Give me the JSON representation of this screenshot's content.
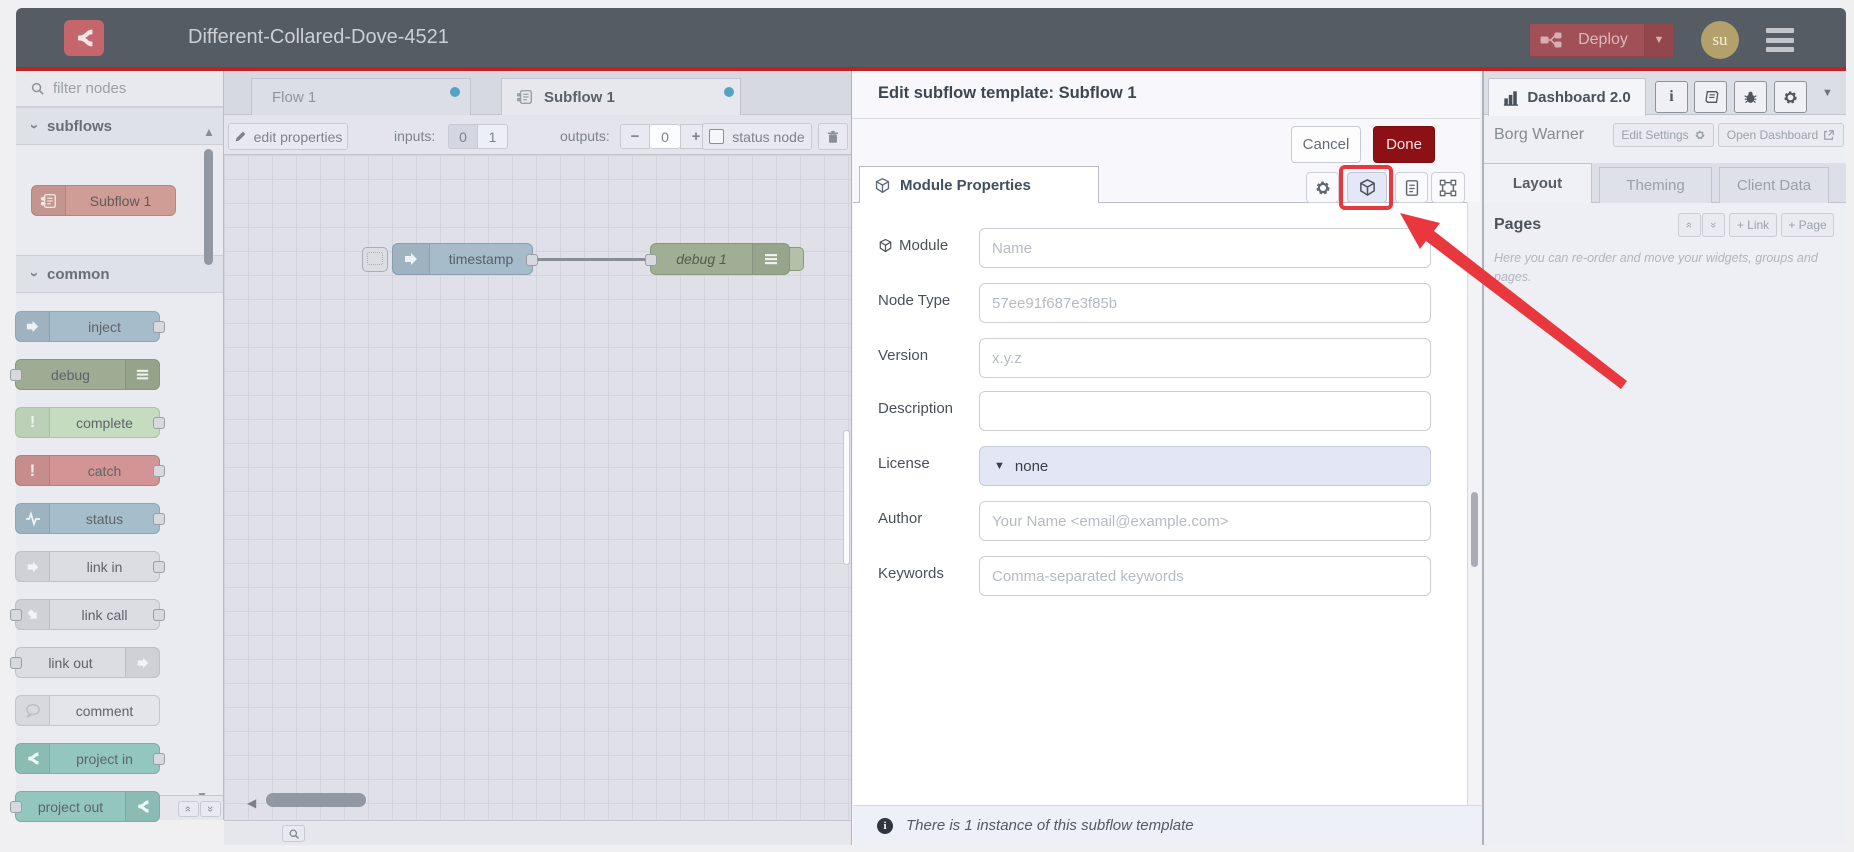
{
  "header": {
    "title": "Different-Collared-Dove-4521",
    "deploy_label": "Deploy",
    "avatar_initials": "su"
  },
  "palette": {
    "filter_placeholder": "filter nodes",
    "category_subflows": "subflows",
    "category_common": "common",
    "nodes": {
      "subflow1": "Subflow 1",
      "inject": "inject",
      "debug": "debug",
      "complete": "complete",
      "catch": "catch",
      "status": "status",
      "linkin": "link in",
      "linkcall": "link call",
      "linkout": "link out",
      "comment": "comment",
      "projectin": "project in",
      "projectout": "project out"
    }
  },
  "workspace": {
    "tab_flow1": "Flow 1",
    "tab_subflow1": "Subflow 1",
    "toolbar": {
      "edit_properties": "edit properties",
      "inputs_label": "inputs:",
      "input_opt0": "0",
      "input_opt1": "1",
      "outputs_label": "outputs:",
      "minus": "−",
      "outputs_value": "0",
      "plus": "+",
      "status_node": "status node"
    },
    "node_timestamp": "timestamp",
    "node_debug1": "debug 1"
  },
  "tray": {
    "title": "Edit subflow template: Subflow 1",
    "cancel": "Cancel",
    "done": "Done",
    "tab_label": "Module Properties",
    "rows": [
      {
        "label": "Module",
        "placeholder": "Name"
      },
      {
        "label": "Node Type",
        "placeholder": "57ee91f687e3f85b"
      },
      {
        "label": "Version",
        "placeholder": "x.y.z"
      },
      {
        "label": "Description",
        "placeholder": ""
      },
      {
        "label": "License",
        "value": "none"
      },
      {
        "label": "Author",
        "placeholder": "Your Name <email@example.com>"
      },
      {
        "label": "Keywords",
        "placeholder": "Comma-separated keywords"
      }
    ],
    "footer": "There is 1 instance of this subflow template"
  },
  "sidebar": {
    "tab_dashboard": "Dashboard 2.0",
    "project_name": "Borg Warner",
    "edit_settings": "Edit Settings",
    "open_dashboard": "Open Dashboard",
    "tab_layout": "Layout",
    "tab_theming": "Theming",
    "tab_client_data": "Client Data",
    "pages_label": "Pages",
    "add_link": "+ Link",
    "add_page": "+ Page",
    "help_text": "Here you can re-order and move your widgets, groups and pages."
  },
  "colors": {
    "accent_red": "#c02323",
    "deploy_red": "#8c1016",
    "annotation_red": "#e8373d",
    "unsaved_dot_blue": "#54a3c4"
  }
}
